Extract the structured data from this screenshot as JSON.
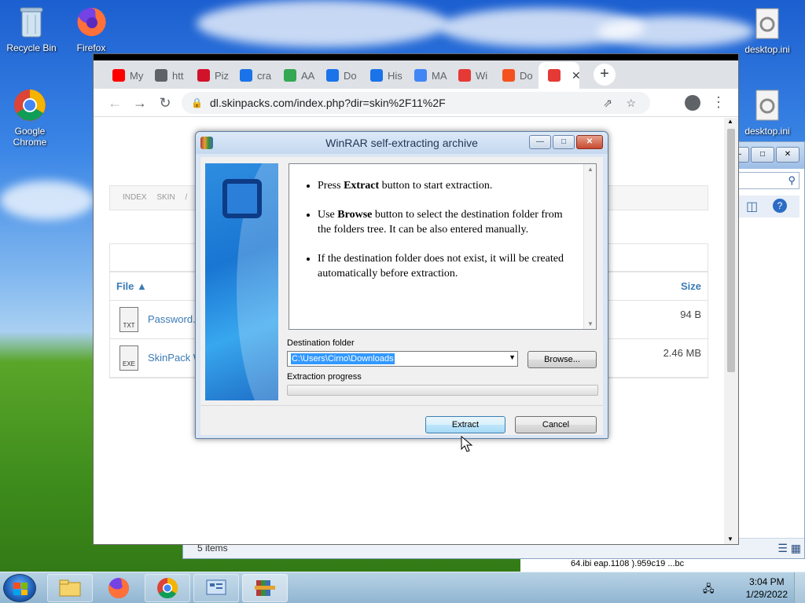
{
  "desktop": {
    "icons": [
      {
        "label": "Recycle Bin"
      },
      {
        "label": "Firefox"
      },
      {
        "label": "Google Chrome"
      },
      {
        "label": "desktop.ini"
      },
      {
        "label": "desktop.ini"
      }
    ]
  },
  "explorer": {
    "status": "5 items",
    "bottom_strip": "64.ibi  eap.1108  ).959c19  ...bc"
  },
  "browser": {
    "tabs": [
      {
        "label": "My",
        "icon": "youtube-icon",
        "color": "#ff0000"
      },
      {
        "label": "htt",
        "icon": "globe-icon",
        "color": "#5f6368"
      },
      {
        "label": "Piz",
        "icon": "pizza-hut-icon",
        "color": "#d1132a"
      },
      {
        "label": "cra",
        "icon": "bing-icon",
        "color": "#1a73e8"
      },
      {
        "label": "AA",
        "icon": "pinwheel-icon",
        "color": "#34a853"
      },
      {
        "label": "Do",
        "icon": "download-icon",
        "color": "#1a73e8"
      },
      {
        "label": "His",
        "icon": "history-icon",
        "color": "#1a73e8"
      },
      {
        "label": "MA",
        "icon": "google-icon",
        "color": "#4285f4"
      },
      {
        "label": "Wi",
        "icon": "skinpack-icon",
        "color": "#e53935"
      },
      {
        "label": "Do",
        "icon": "swirl-icon",
        "color": "#f4511e"
      },
      {
        "label": "",
        "icon": "skinpack-icon",
        "color": "#e53935",
        "active": true
      }
    ],
    "url": "dl.skinpacks.com/index.php?dir=skin%2F11%2F",
    "breadcrumb": [
      "INDEX",
      "SKIN",
      "/"
    ],
    "table": {
      "col_file": "File",
      "col_size": "Size",
      "rows": [
        {
          "icon_tag": "TXT",
          "name": "Password.t",
          "size": "94 B"
        },
        {
          "icon_tag": "EXE",
          "name": "SkinPack W",
          "size": "2.46 MB"
        }
      ]
    }
  },
  "dialog": {
    "title": "WinRAR self-extracting archive",
    "bullets": [
      {
        "pre": "Press ",
        "bold": "Extract",
        "post": " button to start extraction."
      },
      {
        "pre": "Use ",
        "bold": "Browse",
        "post": " button to select the destination folder from the folders tree. It can be also entered manually."
      },
      {
        "pre": "",
        "bold": "",
        "post": "If the destination folder does not exist, it will be created automatically before extraction."
      }
    ],
    "dest_label": "Destination folder",
    "dest_value": "C:\\Users\\Cirno\\Downloads",
    "browse_label": "Browse...",
    "progress_label": "Extraction progress",
    "progress": 0,
    "extract_label": "Extract",
    "cancel_label": "Cancel"
  },
  "taskbar": {
    "time": "3:04 PM",
    "date": "1/29/2022"
  }
}
